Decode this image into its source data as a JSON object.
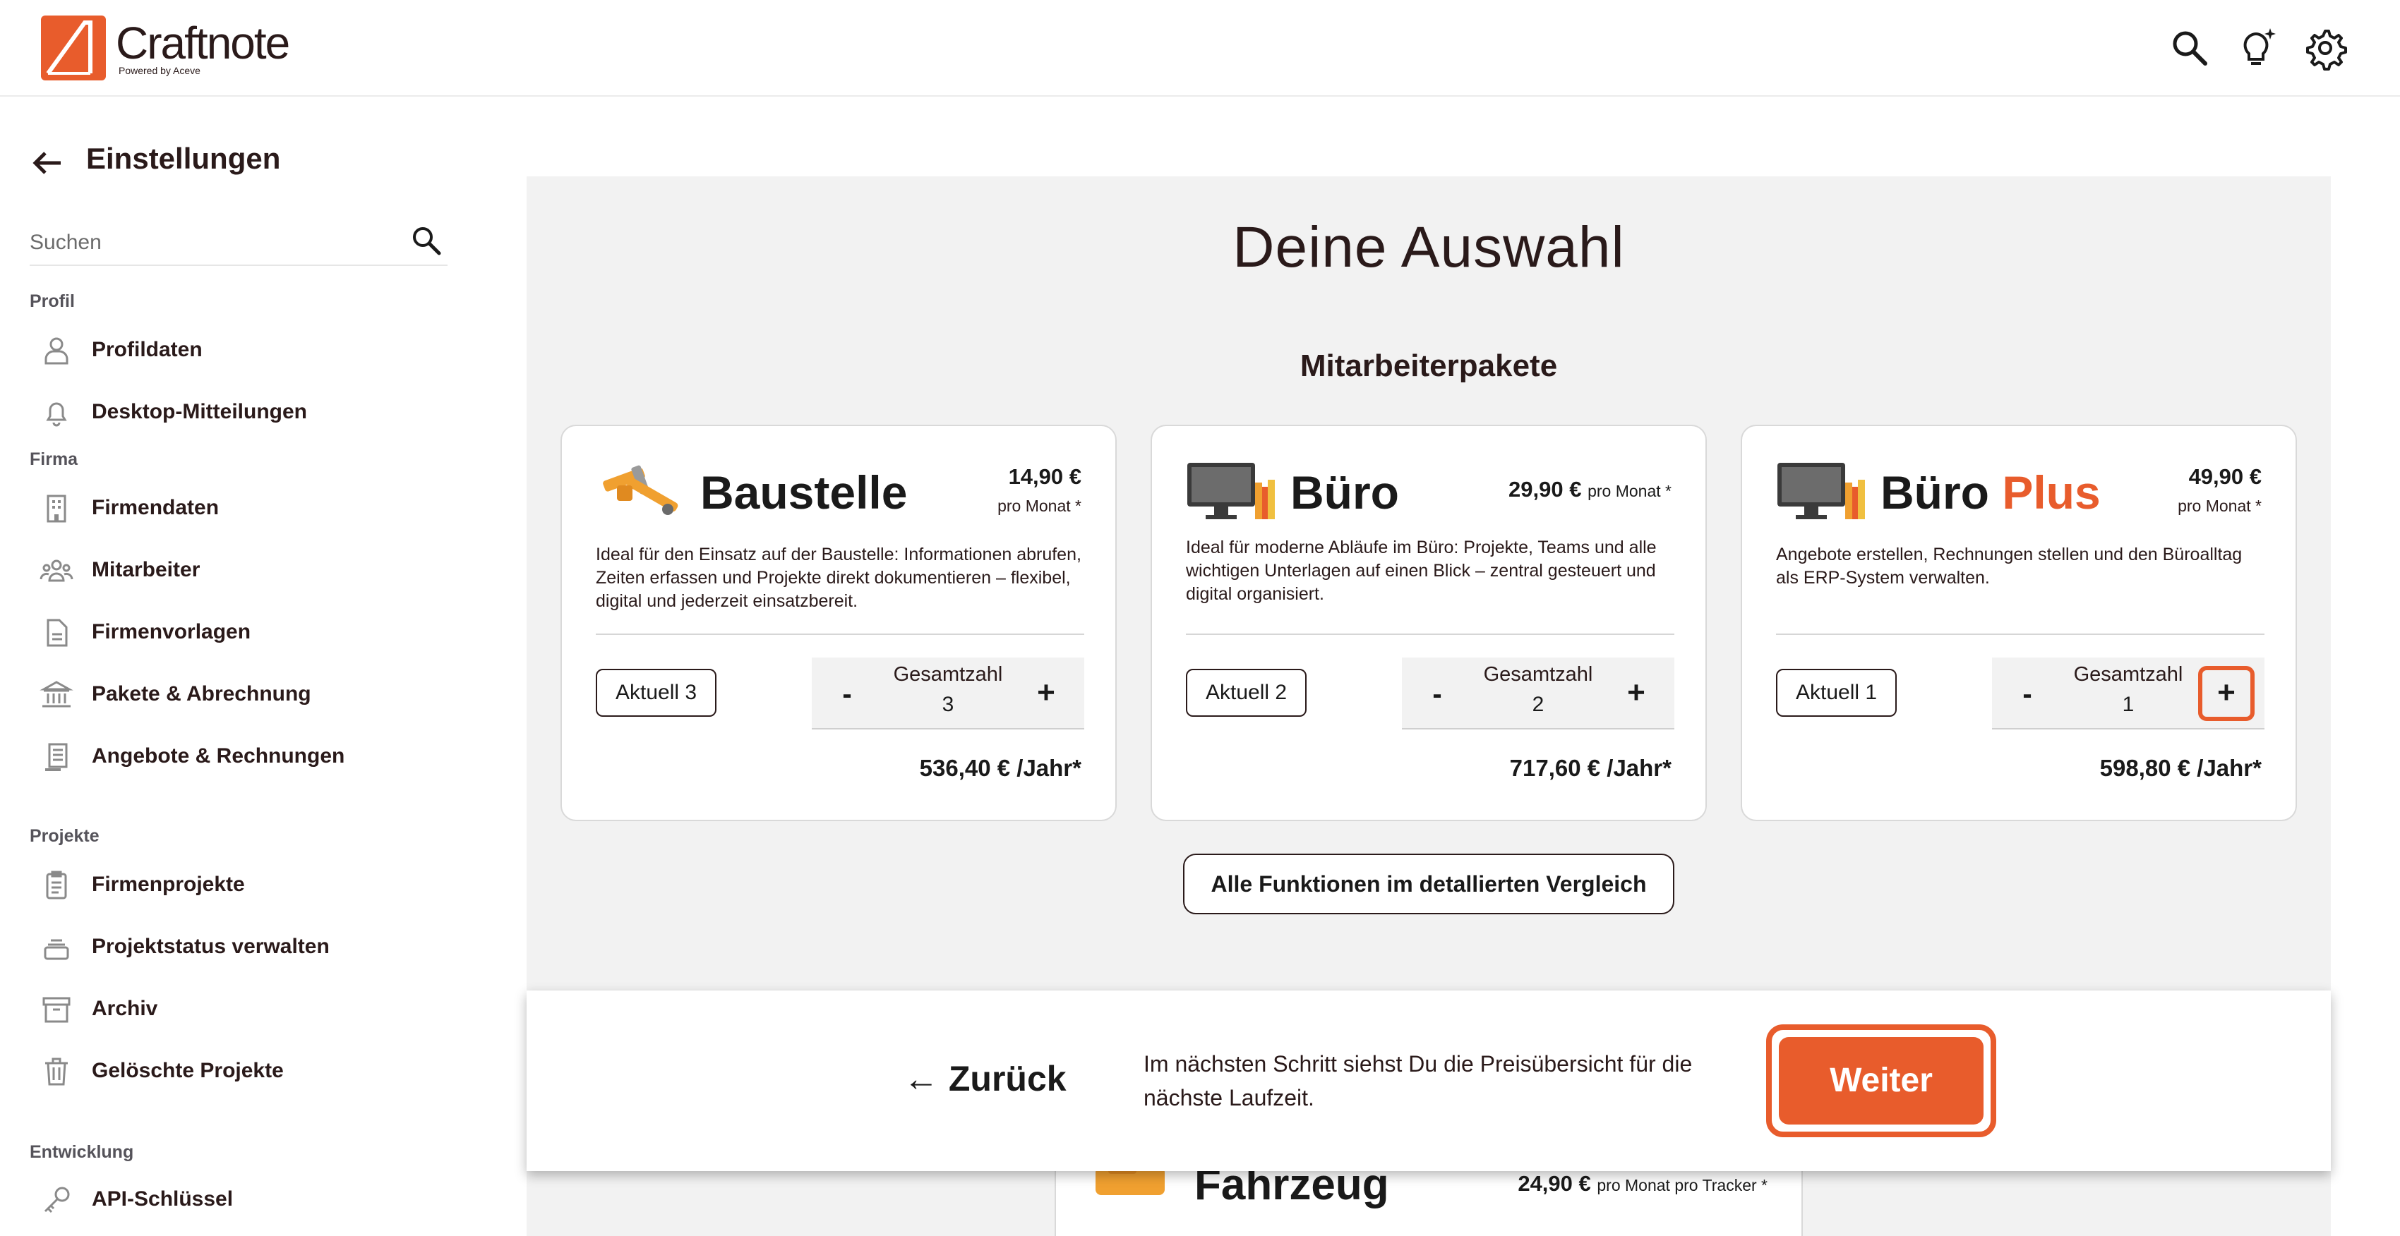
{
  "app": {
    "logo_name": "Craftnote",
    "logo_sub": "Powered by Aceve"
  },
  "header_icons": [
    "search-icon",
    "lightbulb-icon",
    "gear-icon"
  ],
  "sidebar": {
    "title": "Einstellungen",
    "search_placeholder": "Suchen",
    "sections": {
      "profil": "Profil",
      "firma": "Firma",
      "projekte": "Projekte",
      "entwicklung": "Entwicklung"
    },
    "items": [
      {
        "label": "Profildaten",
        "icon": "person-icon"
      },
      {
        "label": "Desktop-Mitteilungen",
        "icon": "bell-icon"
      },
      {
        "label": "Firmendaten",
        "icon": "building-icon"
      },
      {
        "label": "Mitarbeiter",
        "icon": "team-icon"
      },
      {
        "label": "Firmenvorlagen",
        "icon": "document-icon"
      },
      {
        "label": "Pakete & Abrechnung",
        "icon": "bank-icon"
      },
      {
        "label": "Angebote & Rechnungen",
        "icon": "invoice-icon"
      },
      {
        "label": "Firmenprojekte",
        "icon": "clipboard-icon"
      },
      {
        "label": "Projektstatus verwalten",
        "icon": "stack-icon"
      },
      {
        "label": "Archiv",
        "icon": "archive-icon"
      },
      {
        "label": "Gelöschte Projekte",
        "icon": "trash-icon"
      },
      {
        "label": "API-Schlüssel",
        "icon": "key-icon"
      }
    ]
  },
  "main": {
    "title": "Deine Auswahl",
    "section_heading": "Mitarbeiterpakete",
    "packages": [
      {
        "name": "Baustelle",
        "name_accent": "",
        "price": "14,90 €",
        "price_unit": "pro Monat *",
        "description": "Ideal für den Einsatz auf der Baustelle: Informationen abrufen, Zeiten erfassen und Projekte direkt dokumentieren – flexibel, digital und jederzeit einsatzbereit.",
        "current": "Aktuell 3",
        "total_label": "Gesamtzahl",
        "total_value": 3,
        "minus": "-",
        "plus": "+",
        "yearly": "536,40 € /Jahr*",
        "icon": "tools-icon"
      },
      {
        "name": "Büro",
        "name_accent": "",
        "price": "29,90 €",
        "price_unit": "pro Monat *",
        "description": "Ideal für moderne Abläufe im Büro: Projekte, Teams und alle wichtigen Unterlagen auf einen Blick – zentral gesteuert und digital organisiert.",
        "current": "Aktuell 2",
        "total_label": "Gesamtzahl",
        "total_value": 2,
        "minus": "-",
        "plus": "+",
        "yearly": "717,60 € /Jahr*",
        "icon": "monitor-books-icon"
      },
      {
        "name": "Büro",
        "name_accent": "Plus",
        "price": "49,90 €",
        "price_unit": "pro Monat *",
        "description": "Angebote erstellen, Rechnungen stellen und den Büroalltag als ERP-System verwalten.",
        "current": "Aktuell 1",
        "total_label": "Gesamtzahl",
        "total_value": 1,
        "minus": "-",
        "plus": "+",
        "yearly": "598,80 € /Jahr*",
        "icon": "monitor-books-icon"
      }
    ],
    "compare_button": "Alle Funktionen im detallierten Vergleich",
    "peek_package": {
      "name": "Fahrzeug",
      "price": "24,90 €",
      "price_unit": "pro Monat pro Tracker *"
    }
  },
  "action_bar": {
    "back_label": "← Zurück",
    "hint": "Im nächsten Schritt siehst Du die Preisübersicht für die nächste Laufzeit.",
    "next_label": "Weiter"
  },
  "colors": {
    "accent": "#e85c2c",
    "panel_bg": "#f2f2f2",
    "text": "#2a1a1a"
  }
}
